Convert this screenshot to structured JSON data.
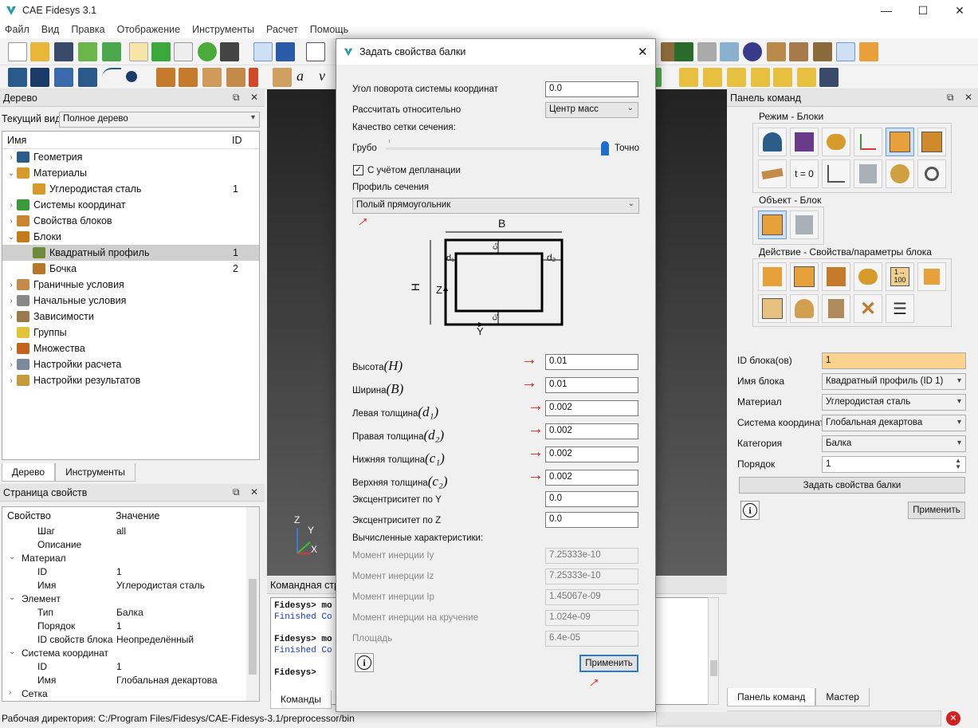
{
  "window": {
    "title": "CAE Fidesys 3.1",
    "minimize": "—",
    "maximize": "☐",
    "close": "✕"
  },
  "menu": [
    "Файл",
    "Вид",
    "Правка",
    "Отображение",
    "Инструменты",
    "Расчет",
    "Помощь"
  ],
  "tree_panel": {
    "title": "Дерево",
    "current_view_label": "Текущий вид",
    "current_view_value": "Полное дерево",
    "col_name": "Имя",
    "col_id": "ID",
    "items": [
      {
        "label": "Геометрия",
        "arrow": "›",
        "indent": 0,
        "id": "",
        "icon": "geometry-icon",
        "color": "#2c5d8a"
      },
      {
        "label": "Материалы",
        "arrow": "⌄",
        "indent": 0,
        "id": "",
        "icon": "materials-icon",
        "color": "#d79b2b"
      },
      {
        "label": "Углеродистая сталь",
        "arrow": "",
        "indent": 1,
        "id": "1",
        "icon": "material-icon",
        "color": "#d79b2b"
      },
      {
        "label": "Системы координат",
        "arrow": "›",
        "indent": 0,
        "id": "",
        "icon": "axes-icon",
        "color": "#3a9a3a"
      },
      {
        "label": "Свойства блоков",
        "arrow": "›",
        "indent": 0,
        "id": "",
        "icon": "beam-icon",
        "color": "#c9852f"
      },
      {
        "label": "Блоки",
        "arrow": "⌄",
        "indent": 0,
        "id": "",
        "icon": "blocks-icon",
        "color": "#c47b1a"
      },
      {
        "label": "Квадратный профиль",
        "arrow": "",
        "indent": 1,
        "id": "1",
        "icon": "block-icon",
        "color": "#6f8a3a",
        "selected": true
      },
      {
        "label": "Бочка",
        "arrow": "",
        "indent": 1,
        "id": "2",
        "icon": "block-icon",
        "color": "#b7772a"
      },
      {
        "label": "Граничные условия",
        "arrow": "›",
        "indent": 0,
        "id": "",
        "icon": "boundary-icon",
        "color": "#c48a4a"
      },
      {
        "label": "Начальные условия",
        "arrow": "›",
        "indent": 0,
        "id": "",
        "icon": "initial-icon",
        "color": "#888888"
      },
      {
        "label": "Зависимости",
        "arrow": "›",
        "indent": 0,
        "id": "",
        "icon": "dependency-icon",
        "color": "#9a7a4a"
      },
      {
        "label": "Группы",
        "arrow": "",
        "indent": 0,
        "id": "",
        "icon": "groups-icon",
        "color": "#e2c43a"
      },
      {
        "label": "Множества",
        "arrow": "›",
        "indent": 0,
        "id": "",
        "icon": "sets-icon",
        "color": "#c4641a"
      },
      {
        "label": "Настройки расчета",
        "arrow": "›",
        "indent": 0,
        "id": "",
        "icon": "calc-settings-icon",
        "color": "#7a8a9a"
      },
      {
        "label": "Настройки результатов",
        "arrow": "›",
        "indent": 0,
        "id": "",
        "icon": "results-icon",
        "color": "#c49a3a"
      }
    ],
    "tab_tree": "Дерево",
    "tab_tools": "Инструменты"
  },
  "props_panel": {
    "title": "Страница свойств",
    "col_prop": "Свойство",
    "col_value": "Значение",
    "rows": [
      {
        "k": "Шаг",
        "v": "all",
        "indent": 2,
        "arrow": ""
      },
      {
        "k": "Описание",
        "v": "",
        "indent": 2,
        "arrow": ""
      },
      {
        "k": "Материал",
        "v": "",
        "indent": 1,
        "arrow": "⌄"
      },
      {
        "k": "ID",
        "v": "1",
        "indent": 2,
        "arrow": ""
      },
      {
        "k": "Имя",
        "v": "Углеродистая сталь",
        "indent": 2,
        "arrow": ""
      },
      {
        "k": "Элемент",
        "v": "",
        "indent": 1,
        "arrow": "⌄"
      },
      {
        "k": "Тип",
        "v": "Балка",
        "indent": 2,
        "arrow": ""
      },
      {
        "k": "Порядок",
        "v": "1",
        "indent": 2,
        "arrow": ""
      },
      {
        "k": "ID свойств блока",
        "v": "Неопределённый",
        "indent": 2,
        "arrow": ""
      },
      {
        "k": "Система координат",
        "v": "",
        "indent": 1,
        "arrow": "⌄"
      },
      {
        "k": "ID",
        "v": "1",
        "indent": 2,
        "arrow": ""
      },
      {
        "k": "Имя",
        "v": "Глобальная декартова",
        "indent": 2,
        "arrow": ""
      },
      {
        "k": "Сетка",
        "v": "",
        "indent": 1,
        "arrow": "›"
      }
    ]
  },
  "statusbar": {
    "text": "Рабочая директория: C:/Program Files/Fidesys/CAE-Fidesys-3.1/preprocessor/bin"
  },
  "command_window": {
    "title": "Командная стр",
    "lines": [
      {
        "text": "Fidesys> mo",
        "kind": "prompt"
      },
      {
        "text": "Finished Co",
        "kind": "info"
      },
      {
        "text": "",
        "kind": "blank"
      },
      {
        "text": "Fidesys> mo",
        "kind": "prompt"
      },
      {
        "text": "Finished Co",
        "kind": "info"
      },
      {
        "text": "",
        "kind": "blank"
      },
      {
        "text": "Fidesys>",
        "kind": "prompt"
      }
    ],
    "tab_commands": "Команды"
  },
  "axes": {
    "z": "Z",
    "y": "Y",
    "x": "X"
  },
  "dialog": {
    "title": "Задать свойства балки",
    "rotation_label": "Угол поворота системы координат",
    "rotation_value": "0.0",
    "relative_label": "Рассчитать относительно",
    "relative_value": "Центр масс",
    "mesh_quality_label": "Качество сетки сечения:",
    "coarse": "Грубо",
    "fine": "Точно",
    "mesh_quality_level": 1.0,
    "warping_label": "С учётом депланации",
    "warping_checked": true,
    "profile_label": "Профиль сечения",
    "profile_value": "Полый прямоугольник",
    "sketch": {
      "B": "B",
      "H": "H",
      "d1": "d₁",
      "d2": "d₂",
      "c1": "c₁",
      "c2": "c₂",
      "Z": "Z",
      "Y": "Y"
    },
    "params": [
      {
        "label": "Высота",
        "math": "(H)",
        "value": "0.01"
      },
      {
        "label": "Ширина",
        "math": "(B)",
        "value": "0.01"
      },
      {
        "label": "Левая толщина",
        "math": "(d₁)",
        "value": "0.002"
      },
      {
        "label": "Правая толщина",
        "math": "(d₂)",
        "value": "0.002"
      },
      {
        "label": "Нижняя толщина",
        "math": "(c₁)",
        "value": "0.002"
      },
      {
        "label": "Верхняя толщина",
        "math": "(c₂)",
        "value": "0.002"
      }
    ],
    "ecc_y_label": "Эксцентриситет по Y",
    "ecc_y_value": "0.0",
    "ecc_z_label": "Эксцентриситет по Z",
    "ecc_z_value": "0.0",
    "computed_label": "Вычисленные характеристики:",
    "computed": [
      {
        "label": "Момент инерции Iy",
        "value": "7.25333e-10"
      },
      {
        "label": "Момент инерции Iz",
        "value": "7.25333e-10"
      },
      {
        "label": "Момент инерции Ip",
        "value": "1.45067e-09"
      },
      {
        "label": "Момент инерции на кручение",
        "value": "1.024e-09"
      },
      {
        "label": "Площадь",
        "value": "6.4e-05"
      }
    ],
    "apply": "Применить",
    "info": "i"
  },
  "command_panel": {
    "title": "Панель команд",
    "mode_group": "Режим - Блоки",
    "object_group": "Объект - Блок",
    "action_group": "Действие - Свойства/параметры блока",
    "t0": "t = 0",
    "block_ids_label": "ID блока(ов)",
    "block_ids_value": "1",
    "block_name_label": "Имя блока",
    "block_name_value": "Квадратный профиль (ID 1)",
    "material_label": "Материал",
    "material_value": "Углеродистая сталь",
    "cs_label": "Система координат",
    "cs_value": "Глобальная декартова",
    "category_label": "Категория",
    "category_value": "Балка",
    "order_label": "Порядок",
    "order_value": "1",
    "set_beam_btn": "Задать свойства балки",
    "apply_btn": "Применить",
    "tab_panel": "Панель команд",
    "tab_master": "Мастер",
    "accent": "#fcd38e"
  }
}
